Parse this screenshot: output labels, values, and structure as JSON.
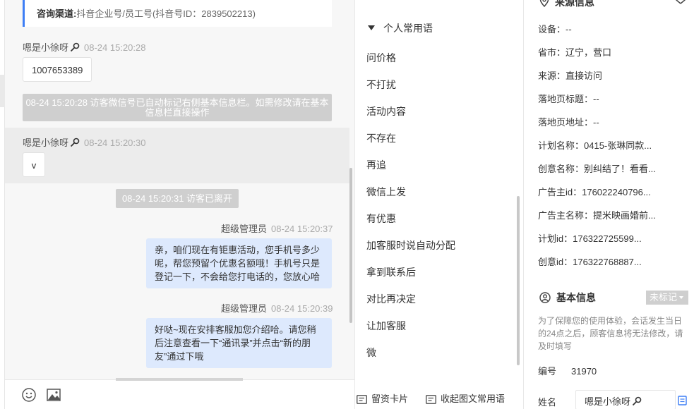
{
  "chat": {
    "channel": {
      "label": "咨询渠道:",
      "value": "抖音企业号/员工号(抖音号ID：2839502213)"
    },
    "messages": [
      {
        "sender": "嗯是小徐呀",
        "time": "08-24 15:20:28",
        "text": "1007653389"
      },
      {
        "system": "08-24 15:20:28 访客微信号已自动标记右侧基本信息栏。如需修改请在基本信息栏直接操作"
      },
      {
        "sender": "嗯是小徐呀",
        "time": "08-24 15:20:30",
        "text": "v"
      },
      {
        "system": "08-24 15:20:31 访客已离开"
      },
      {
        "sender": "超级管理员",
        "time": "08-24 15:20:37",
        "lines": [
          "亲，咱们现在有钜惠活动，您手机号多少",
          "呢，帮您预留个优惠名额哦！手机号只是",
          "登记一下，不会给您打电话的，您放心哈"
        ]
      },
      {
        "sender": "超级管理员",
        "time": "08-24 15:20:39",
        "lines": [
          "好哒~现在安排客服加您介绍哈。请您稍",
          "后注意查看一下“通讯录”并点击“新的朋",
          "友”通过下哦"
        ]
      }
    ],
    "toolbar": {
      "emoji_icon": "smile-icon",
      "image_icon": "image-icon"
    }
  },
  "phrases": {
    "header": "个人常用语",
    "items": [
      "问价格",
      "不打扰",
      "活动内容",
      "不存在",
      "再追",
      "微信上发",
      "有优惠",
      "加客服时说自动分配",
      "拿到联系后",
      "对比再决定",
      "让加客服",
      "微"
    ],
    "footer": {
      "card_label": "留资卡片",
      "collapse_label": "收起图文常用语"
    }
  },
  "info": {
    "source_title": "来源信息",
    "source_rows": [
      "设备：--",
      "省市：辽宁，营口",
      "来源：直接访问",
      "落地页标题：--",
      "落地页地址：--",
      "计划名称：0415-张琳同款...",
      "创意名称：别纠结了！看看...",
      "广告主id：176022240796...",
      "广告主名称：提米映画婚前...",
      "计划id：176322725599...",
      "创意id：176322768887..."
    ],
    "basic_title": "基本信息",
    "tag": "未标记",
    "note": "为了保障您的使用体验，会话发生当日的24点之后，顾客信息将无法修改，请及时填写",
    "id_label": "编号",
    "id_value": "31970",
    "name_label": "姓名",
    "name_value": "嗯是小徐呀"
  },
  "colors": {
    "accent": "#3d7ef5",
    "bubble_out": "#dde9fd",
    "system_bg": "#cfcfcf"
  }
}
